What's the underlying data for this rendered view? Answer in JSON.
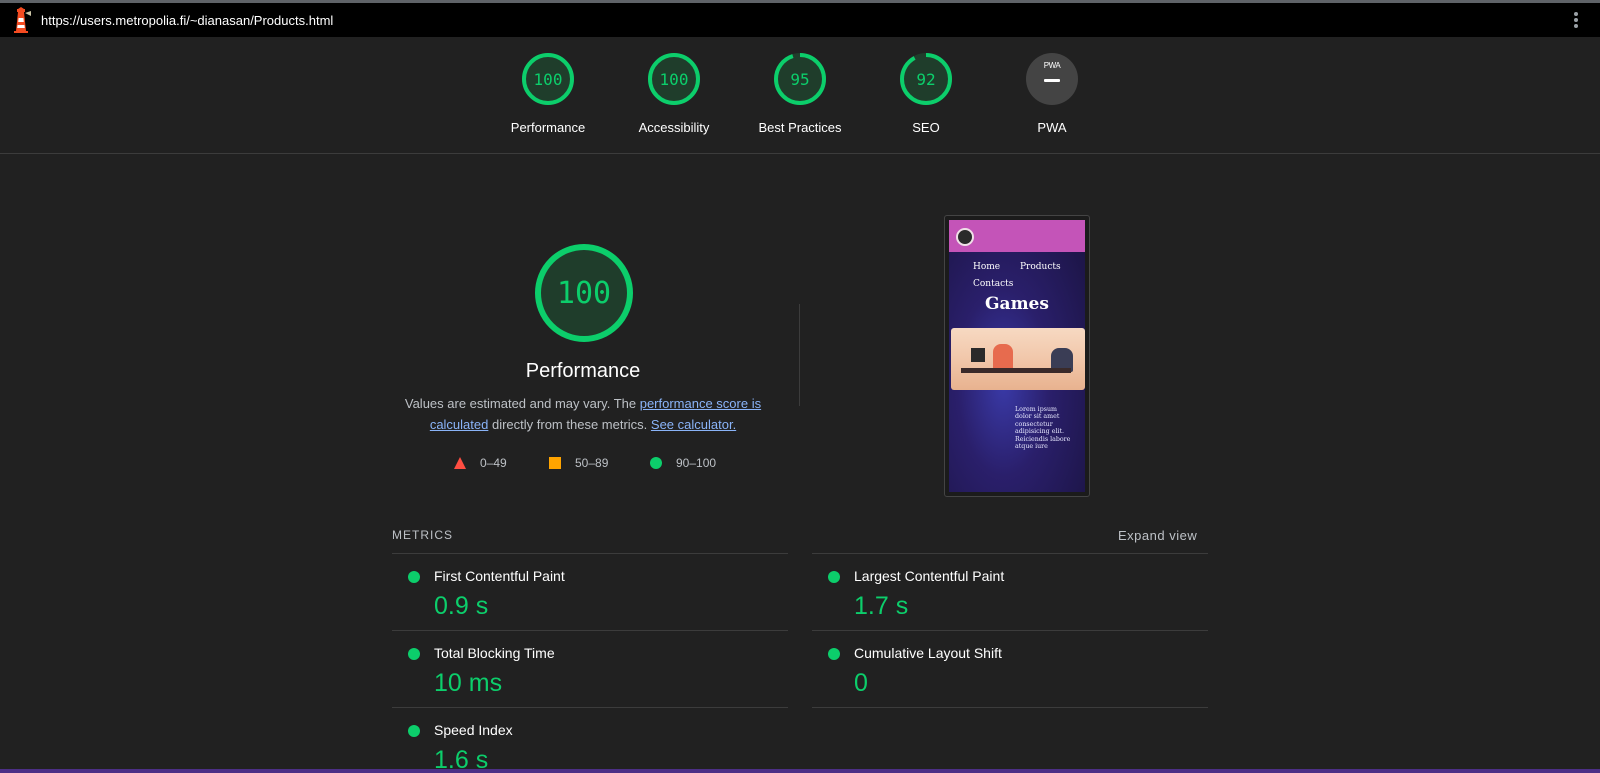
{
  "browser": {
    "url": "https://users.metropolia.fi/~dianasan/Products.html"
  },
  "summary": [
    {
      "score": "100",
      "label": "Performance",
      "value": 100
    },
    {
      "score": "100",
      "label": "Accessibility",
      "value": 100
    },
    {
      "score": "95",
      "label": "Best Practices",
      "value": 95
    },
    {
      "score": "92",
      "label": "SEO",
      "value": 92
    },
    {
      "score": "PWA",
      "label": "PWA"
    }
  ],
  "performance": {
    "score": "100",
    "title": "Performance",
    "desc_prefix": "Values are estimated and may vary. The ",
    "desc_link1": "performance score is calculated",
    "desc_middle": " directly from these metrics. ",
    "desc_link2": "See calculator.",
    "legend": {
      "fail": "0–49",
      "average": "50–89",
      "pass": "90–100"
    }
  },
  "screenshot": {
    "nav_home": "Home",
    "nav_products": "Products",
    "nav_contacts": "Contacts",
    "heading": "Games",
    "lorem": "Lorem ipsum dolor sit amet consectetur adipisicing elit. Reiciendis labore atque iure"
  },
  "metrics": {
    "header": "METRICS",
    "expand": "Expand view",
    "items": [
      {
        "name": "First Contentful Paint",
        "value": "0.9 s"
      },
      {
        "name": "Largest Contentful Paint",
        "value": "1.7 s"
      },
      {
        "name": "Total Blocking Time",
        "value": "10 ms"
      },
      {
        "name": "Cumulative Layout Shift",
        "value": "0"
      },
      {
        "name": "Speed Index",
        "value": "1.6 s"
      }
    ]
  },
  "colors": {
    "pass": "#0cce6b",
    "average": "#ffa400",
    "fail": "#ff4e42",
    "link": "#8ab4f8"
  }
}
